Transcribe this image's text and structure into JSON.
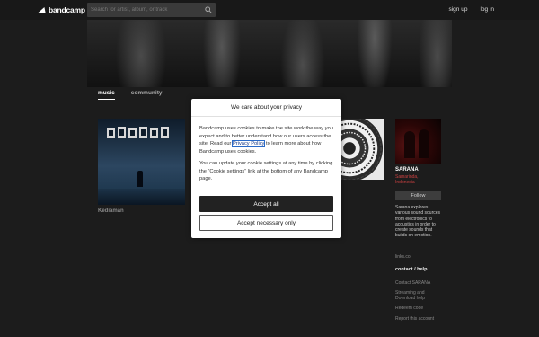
{
  "header": {
    "logo_text": "bandcamp",
    "search_placeholder": "Search for artist, album, or track",
    "signup_label": "sign up",
    "login_label": "log in"
  },
  "tabs": [
    {
      "label": "music",
      "active": true
    },
    {
      "label": "community",
      "active": false
    }
  ],
  "albums": [
    {
      "title": "Kediaman"
    }
  ],
  "sidebar": {
    "artist_name": "SARANA",
    "location_line1": "Samarinda,",
    "location_line2": "Indonesia",
    "follow_label": "Follow",
    "bio": "Sarana explores various sound sources from electronics to acoustics in order to create sounds that builds on emotion.",
    "links_label": "links.co",
    "contact_heading": "contact / help",
    "contact_link": "Contact SARANA",
    "streaming_link": "Streaming and Download help",
    "redeem_link": "Redeem code",
    "report_link": "Report this account"
  },
  "cookie_modal": {
    "title": "We care about your privacy",
    "para1_before": "Bandcamp uses cookies to make the site work the way you expect and to better understand how our users access the site. Read our ",
    "policy_link": "Privacy Policy",
    "para1_after": " to learn more about how Bandcamp uses cookies.",
    "para2": "You can update your cookie settings at any time by clicking the “Cookie settings” link at the bottom of any Bandcamp page.",
    "accept_all": "Accept all",
    "accept_necessary": "Accept necessary only"
  },
  "colors": {
    "background": "#1c1c1c",
    "accent_location": "#c84040",
    "primary_button": "#222222"
  },
  "icons": [
    "bandcamp-logo-icon",
    "search-icon"
  ]
}
